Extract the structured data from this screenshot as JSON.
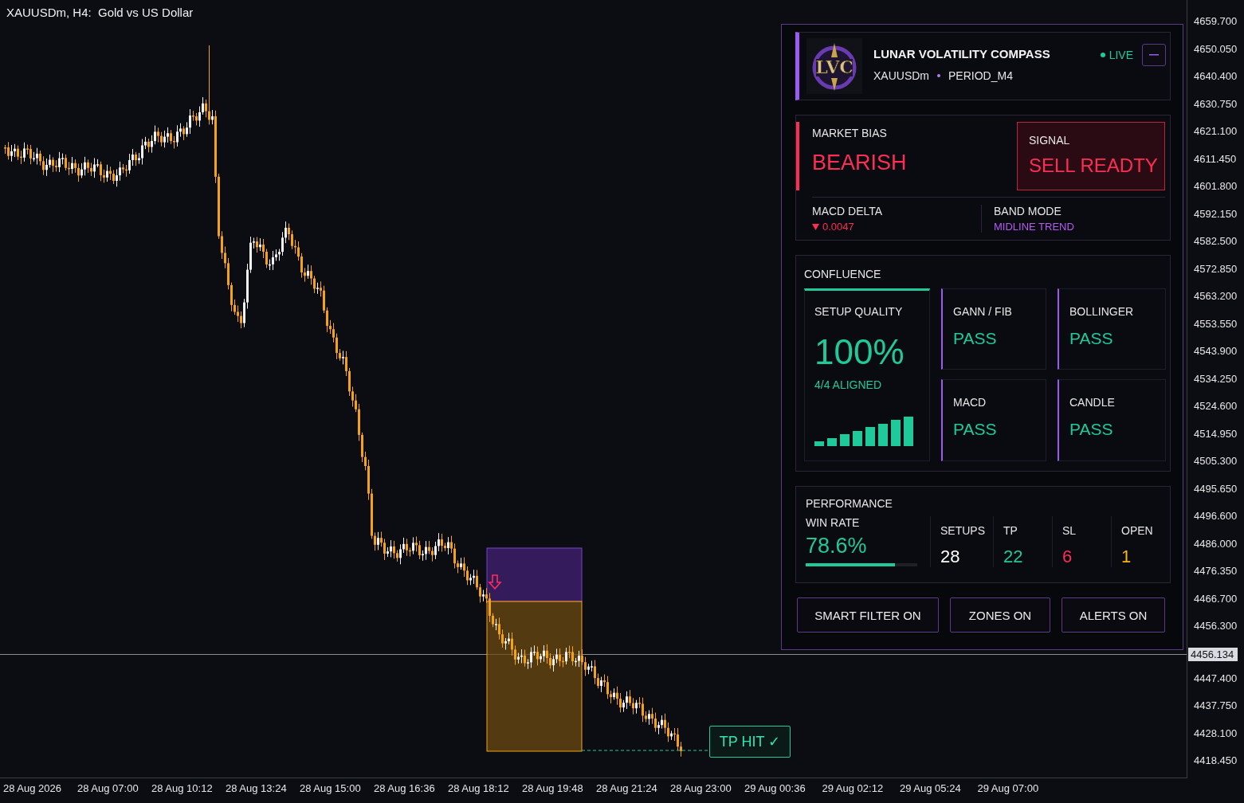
{
  "chart": {
    "title": "XAUUSDm, H4:  Gold vs US Dollar",
    "price_axis": [
      "4659.700",
      "4650.050",
      "4640.400",
      "4630.750",
      "4621.100",
      "4611.450",
      "4601.800",
      "4592.150",
      "4582.500",
      "4572.850",
      "4563.200",
      "4553.550",
      "4543.900",
      "4534.250",
      "4524.600",
      "4514.950",
      "4505.300",
      "4495.650",
      "4496.600",
      "4486.000",
      "4476.350",
      "4466.700",
      "4456.300",
      "4447.400",
      "4437.750",
      "4428.100",
      "4418.450"
    ],
    "current_price": "4456.134",
    "time_axis": [
      "28 Aug 2026",
      "28 Aug 07:00",
      "28 Aug 10:12",
      "28 Aug 13:24",
      "28 Aug 15:00",
      "28 Aug 16:36",
      "28 Aug 18:12",
      "28 Aug 19:48",
      "28 Aug 21:24",
      "28 Aug 23:00",
      "29 Aug 00:36",
      "29 Aug 02:12",
      "29 Aug 05:24",
      "29 Aug 07:00"
    ],
    "trade_label": "TP HIT ✓"
  },
  "panel": {
    "title": "LUNAR VOLATILITY COMPASS",
    "logo_text": "LVC",
    "symbol": "XAUUSDm",
    "period": "PERIOD_M4",
    "status": "LIVE",
    "bias": {
      "label": "MARKET BIAS",
      "value": "BEARISH"
    },
    "signal": {
      "label": "SIGNAL",
      "value": "SELL READTY"
    },
    "macd_delta": {
      "label": "MACD DELTA",
      "value": "0.0047",
      "falling": true
    },
    "band_mode": {
      "label": "BAND MODE",
      "value": "MIDLINE TREND"
    },
    "confluence": {
      "title": "CONFLUENCE",
      "quality": {
        "label": "SETUP QUALITY",
        "value": "100%",
        "aligned": "4/4 ALIGNED"
      },
      "checks": [
        {
          "label": "GANN / FIB",
          "value": "PASS",
          "passed": true
        },
        {
          "label": "BOLLINGER",
          "value": "PASS",
          "passed": true
        },
        {
          "label": "MACD",
          "value": "PASS",
          "passed": true
        },
        {
          "label": "CANDLE",
          "value": "PASS",
          "passed": true
        }
      ]
    },
    "performance": {
      "title": "PERFORMANCE",
      "win_rate": {
        "label": "WIN RATE",
        "value": "78.6%",
        "level": 0.8
      },
      "stats": [
        {
          "label": "SETUPS",
          "value": "28",
          "color": "#ffffff"
        },
        {
          "label": "TP",
          "value": "22",
          "color": "#1fc99a"
        },
        {
          "label": "SL",
          "value": "6",
          "color": "#ff2d55"
        },
        {
          "label": "OPEN",
          "value": "1",
          "color": "#f5b50e"
        }
      ]
    },
    "buttons": [
      {
        "label": "SMART FILTER ON"
      },
      {
        "label": "ZONES ON"
      },
      {
        "label": "ALERTS ON"
      }
    ]
  }
}
